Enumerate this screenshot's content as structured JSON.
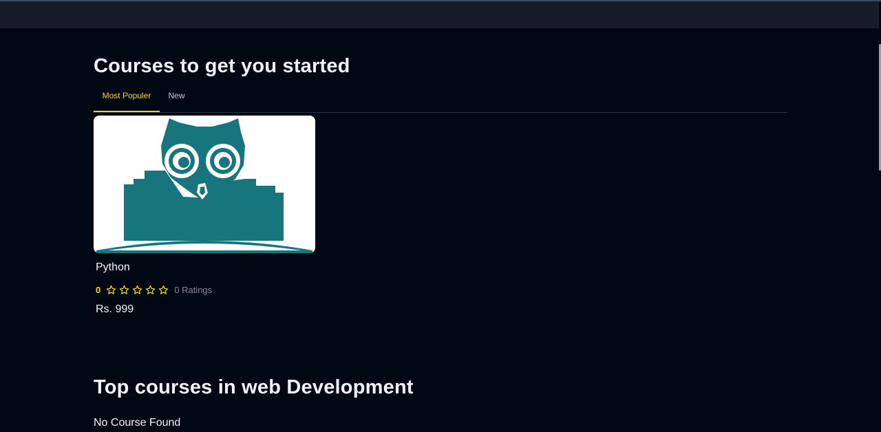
{
  "section1": {
    "heading": "Courses to get you started",
    "tabs": [
      {
        "label": "Most Populer",
        "active": true
      },
      {
        "label": "New",
        "active": false
      }
    ]
  },
  "course": {
    "name": "Python",
    "rating_value": "0",
    "stars": 5,
    "rating_count": "0 Ratings",
    "price": "Rs. 999",
    "thumbnail_icon": "owl-logo-icon"
  },
  "section2": {
    "heading": "Top courses in web Development",
    "empty_message": "No Course Found"
  },
  "colors": {
    "background": "#000814",
    "topbar": "#161d29",
    "accent": "#ffd60a",
    "owl": "#17767d"
  }
}
